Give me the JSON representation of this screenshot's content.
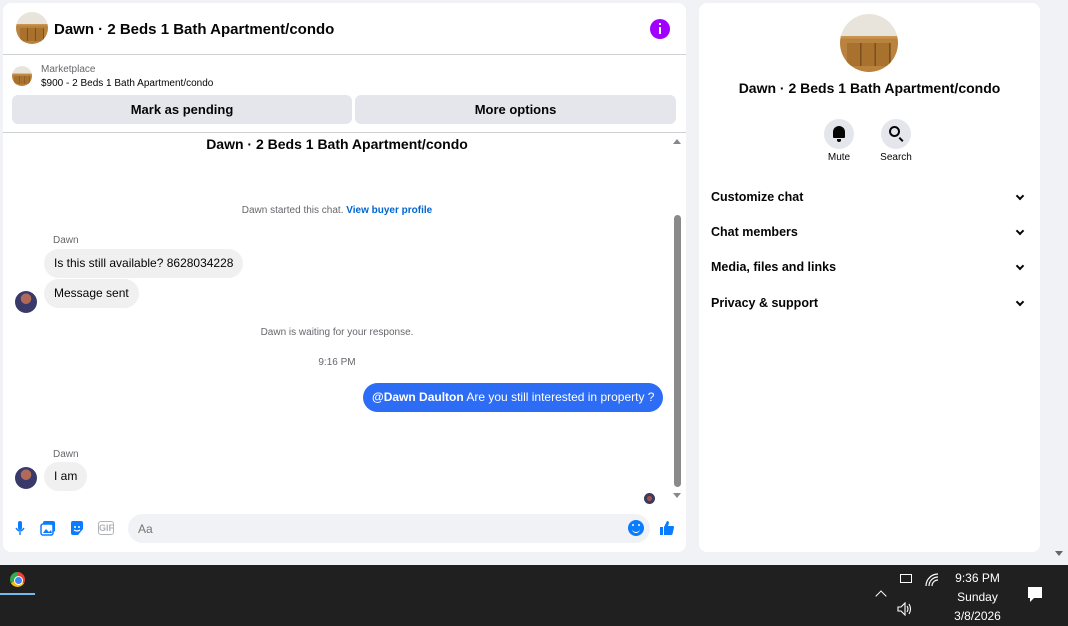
{
  "chat": {
    "header_title": "Dawn · 2 Beds 1 Bath Apartment/condo",
    "marketplace_label": "Marketplace",
    "marketplace_listing": "$900 - 2 Beds 1 Bath Apartment/condo",
    "mark_pending_label": "Mark as pending",
    "more_options_label": "More options",
    "conversation_title": "Dawn · 2 Beds 1 Bath Apartment/condo",
    "started_text": "Dawn started this chat.",
    "view_buyer_profile": "View buyer profile",
    "messages": [
      {
        "sender": "Dawn",
        "text": "Is this still available? 8628034228"
      },
      {
        "text": "Message sent"
      }
    ],
    "waiting_text": "Dawn is waiting for your response.",
    "timestamp": "9:16 PM",
    "outgoing_mention": "@Dawn Daulton",
    "outgoing_text": " Are you still interested in property ?",
    "reply_sender": "Dawn",
    "reply_text": "I am",
    "input_placeholder": "Aa",
    "accent_color": "#0a7cff",
    "outgoing_bubble_color": "#2d6cf5"
  },
  "info_panel": {
    "title": "Dawn · 2 Beds 1 Bath Apartment/condo",
    "mute_label": "Mute",
    "search_label": "Search",
    "sections": [
      "Customize chat",
      "Chat members",
      "Media, files and links",
      "Privacy & support"
    ]
  },
  "taskbar": {
    "time": "9:36 PM",
    "day": "Sunday",
    "date": "3/8/2026"
  },
  "icons": [
    "info-icon",
    "mic-icon",
    "photo-icon",
    "sticker-icon",
    "gif-icon",
    "emoji-icon",
    "like-icon",
    "bell-icon",
    "search-icon",
    "chevron-down-icon",
    "chrome-icon",
    "notification-icon"
  ]
}
